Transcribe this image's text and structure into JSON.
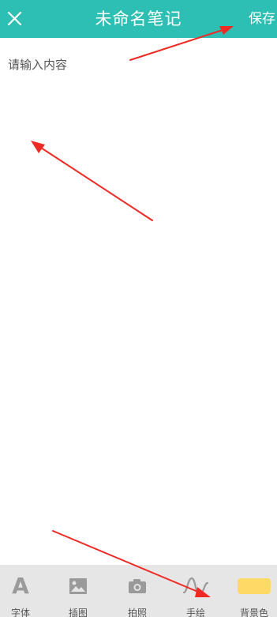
{
  "header": {
    "close_icon": "close-icon",
    "title": "未命名笔记",
    "save_label": "保存"
  },
  "editor": {
    "placeholder": "请输入内容",
    "value": ""
  },
  "toolbar": {
    "items": [
      {
        "label": "字体",
        "icon": "font-icon"
      },
      {
        "label": "插图",
        "icon": "image-icon"
      },
      {
        "label": "拍照",
        "icon": "camera-icon"
      },
      {
        "label": "手绘",
        "icon": "freehand-icon"
      },
      {
        "label": "背景色",
        "icon": "background-color-swatch"
      }
    ]
  },
  "colors": {
    "header_bg": "#2dbfb3",
    "toolbar_bg": "#e6e6e6",
    "icon_gray": "#9a9a9a",
    "swatch_yellow": "#ffd966",
    "annotation_red": "#ee2a24"
  }
}
